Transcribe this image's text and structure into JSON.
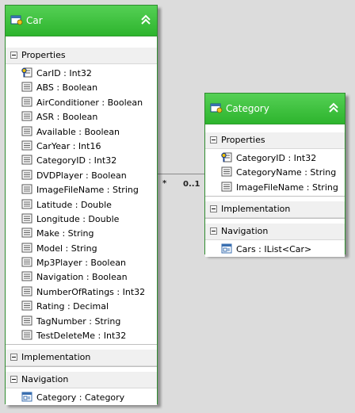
{
  "car": {
    "title": "Car",
    "sections": {
      "properties_label": "Properties",
      "implementation_label": "Implementation",
      "navigation_label": "Navigation"
    },
    "properties": [
      {
        "text": "CarID : Int32",
        "icon": "key-property-icon"
      },
      {
        "text": "ABS : Boolean",
        "icon": "property-icon"
      },
      {
        "text": "AirConditioner : Boolean",
        "icon": "property-icon"
      },
      {
        "text": "ASR : Boolean",
        "icon": "property-icon"
      },
      {
        "text": "Available : Boolean",
        "icon": "property-icon"
      },
      {
        "text": "CarYear : Int16",
        "icon": "property-icon"
      },
      {
        "text": "CategoryID : Int32",
        "icon": "property-icon"
      },
      {
        "text": "DVDPlayer : Boolean",
        "icon": "property-icon"
      },
      {
        "text": "ImageFileName : String",
        "icon": "property-icon"
      },
      {
        "text": "Latitude : Double",
        "icon": "property-icon"
      },
      {
        "text": "Longitude : Double",
        "icon": "property-icon"
      },
      {
        "text": "Make : String",
        "icon": "property-icon"
      },
      {
        "text": "Model : String",
        "icon": "property-icon"
      },
      {
        "text": "Mp3Player : Boolean",
        "icon": "property-icon"
      },
      {
        "text": "Navigation : Boolean",
        "icon": "property-icon"
      },
      {
        "text": "NumberOfRatings : Int32",
        "icon": "property-icon"
      },
      {
        "text": "Rating : Decimal",
        "icon": "property-icon"
      },
      {
        "text": "TagNumber : String",
        "icon": "property-icon"
      },
      {
        "text": "TestDeleteMe : Int32",
        "icon": "property-icon"
      }
    ],
    "navigation": [
      {
        "text": "Category : Category",
        "icon": "navigation-property-icon"
      }
    ]
  },
  "category": {
    "title": "Category",
    "sections": {
      "properties_label": "Properties",
      "implementation_label": "Implementation",
      "navigation_label": "Navigation"
    },
    "properties": [
      {
        "text": "CategoryID : Int32",
        "icon": "key-property-icon"
      },
      {
        "text": "CategoryName : String",
        "icon": "property-icon"
      },
      {
        "text": "ImageFileName : String",
        "icon": "property-icon"
      }
    ],
    "navigation": [
      {
        "text": "Cars : IList<Car>",
        "icon": "navigation-property-icon"
      }
    ]
  },
  "association": {
    "car_end_multiplicity": "*",
    "category_end_multiplicity": "0..1"
  },
  "colors": {
    "header_green": "#2db42d",
    "canvas": "#dcdcdc"
  }
}
